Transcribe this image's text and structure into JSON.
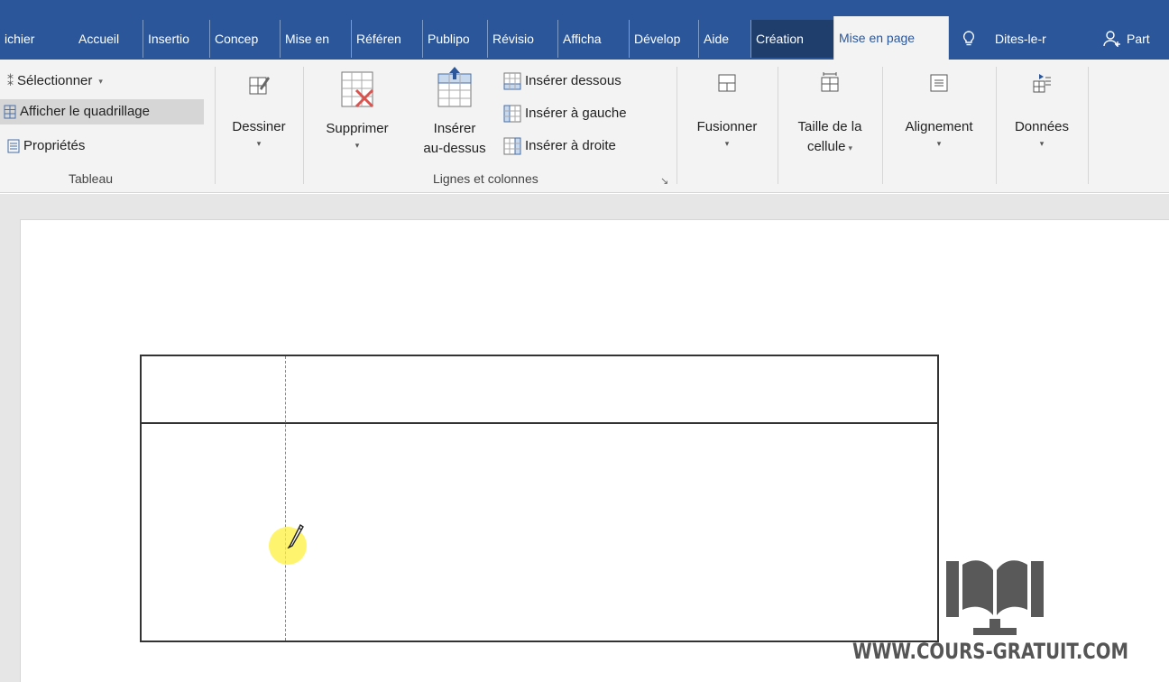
{
  "tabs": [
    {
      "label": "ichier"
    },
    {
      "label": "Accueil"
    },
    {
      "label": "Insertio"
    },
    {
      "label": "Concep"
    },
    {
      "label": "Mise en"
    },
    {
      "label": "Référen"
    },
    {
      "label": "Publipo"
    },
    {
      "label": "Révisio"
    },
    {
      "label": "Afficha"
    },
    {
      "label": "Dévelop"
    },
    {
      "label": "Aide"
    },
    {
      "label": "Création"
    },
    {
      "label": "Mise en page"
    },
    {
      "label": "Dites-le-r"
    },
    {
      "label": "Part"
    }
  ],
  "ribbon": {
    "tableau": {
      "selectionner": "Sélectionner",
      "afficher_quadrillage": "Afficher le quadrillage",
      "proprietes": "Propriétés",
      "label": "Tableau"
    },
    "dessiner": {
      "label": "Dessiner"
    },
    "lignes_colonnes": {
      "supprimer": "Supprimer",
      "inserer_line1": "Insérer",
      "inserer_line2": "au-dessus",
      "inserer_dessous": "Insérer dessous",
      "inserer_gauche": "Insérer à gauche",
      "inserer_droite": "Insérer à droite",
      "label": "Lignes et colonnes"
    },
    "fusionner": {
      "label": "Fusionner"
    },
    "taille": {
      "line1": "Taille de la",
      "line2": "cellule"
    },
    "alignement": {
      "label": "Alignement"
    },
    "donnees": {
      "label": "Données"
    }
  },
  "watermark": {
    "text": "WWW.COURS-GRATUIT.COM"
  },
  "colors": {
    "tab_bar": "#2b579a",
    "ribbon": "#f3f3f3",
    "contextual_tab": "#203e6b",
    "cursor_highlight": "#fff03c"
  }
}
